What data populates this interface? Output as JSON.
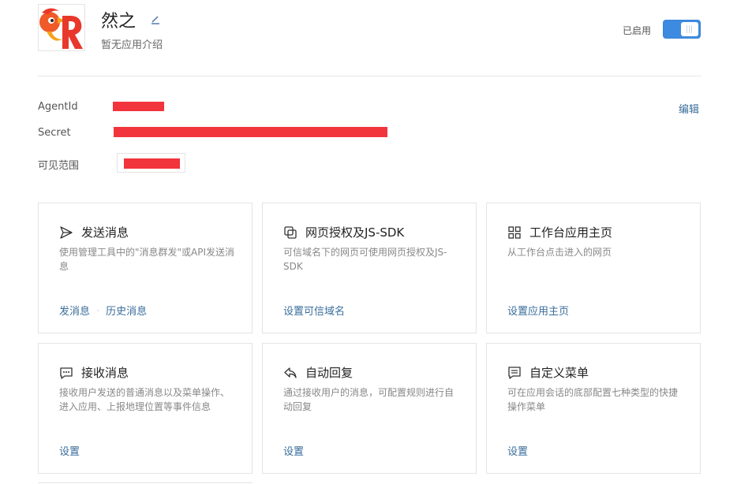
{
  "app": {
    "name": "然之",
    "description": "暂无应用介绍",
    "status_label": "已启用",
    "enabled": true
  },
  "info": {
    "agentid_label": "AgentId",
    "secret_label": "Secret",
    "scope_label": "可见范围",
    "edit_label": "编辑"
  },
  "cards": [
    {
      "title": "发送消息",
      "icon": "send-icon",
      "desc": "使用管理工具中的\"消息群发\"或API发送消息",
      "links": [
        "发消息",
        "历史消息"
      ]
    },
    {
      "title": "网页授权及JS-SDK",
      "icon": "copy-icon",
      "desc": "可信域名下的网页可使用网页授权及JS-SDK",
      "links": [
        "设置可信域名"
      ]
    },
    {
      "title": "工作台应用主页",
      "icon": "grid-icon",
      "desc": "从工作台点击进入的网页",
      "links": [
        "设置应用主页"
      ]
    },
    {
      "title": "接收消息",
      "icon": "chat-icon",
      "desc": "接收用户发送的普通消息以及菜单操作、进入应用、上报地理位置等事件信息",
      "links": [
        "设置"
      ]
    },
    {
      "title": "自动回复",
      "icon": "reply-icon",
      "desc": "通过接收用户的消息，可配置规则进行自动回复",
      "links": [
        "设置"
      ]
    },
    {
      "title": "自定义菜单",
      "icon": "menu-icon",
      "desc": "可在应用会话的底部配置七种类型的快捷操作菜单",
      "links": [
        "设置"
      ]
    }
  ],
  "colors": {
    "accent": "#3d8be0",
    "link": "#3a6d9b",
    "redaction": "#f2343d"
  }
}
